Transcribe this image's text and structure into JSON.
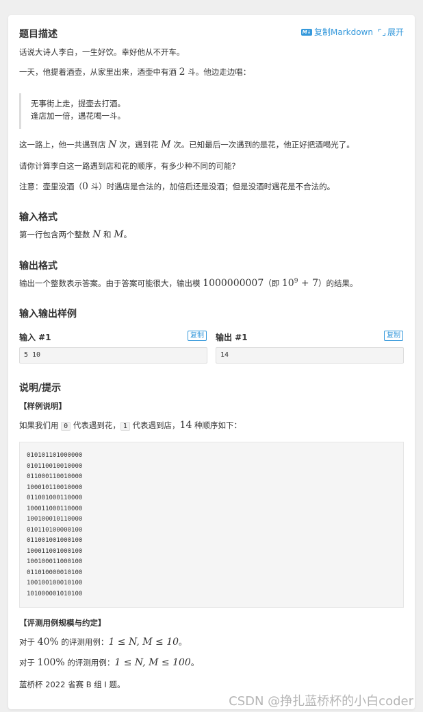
{
  "header": {
    "title": "题目描述",
    "copy_markdown": "复制Markdown",
    "expand": "展开"
  },
  "description": {
    "p1": "话说大诗人李白，一生好饮。幸好他从不开车。",
    "p2_a": "一天，他提着酒壶，从家里出来，酒壶中有酒 ",
    "p2_num": "2",
    "p2_b": " 斗。他边走边唱：",
    "quote_line1": "无事街上走，提壶去打酒。",
    "quote_line2": "逢店加一倍，遇花喝一斗。",
    "p3_a": "这一路上，他一共遇到店 ",
    "p3_N": "N",
    "p3_b": " 次，遇到花 ",
    "p3_M": "M",
    "p3_c": " 次。已知最后一次遇到的是花，他正好把酒喝光了。",
    "p4": "请你计算李白这一路遇到店和花的顺序，有多少种不同的可能?",
    "p5_a": "注意：壶里没酒（",
    "p5_num": "0",
    "p5_b": " 斗）时遇店是合法的，加倍后还是没酒；但是没酒时遇花是不合法的。"
  },
  "input_format": {
    "title": "输入格式",
    "text_a": "第一行包含两个整数 ",
    "N": "N",
    "text_b": " 和 ",
    "M": "M",
    "text_c": "。"
  },
  "output_format": {
    "title": "输出格式",
    "text_a": "输出一个整数表示答案。由于答案可能很大，输出模 ",
    "mod": "1000000007",
    "text_b": "（即 ",
    "pow_base": "10",
    "pow_exp": "9",
    "pow_rest": " + 7",
    "text_c": "）的结果。"
  },
  "samples": {
    "title": "输入输出样例",
    "input_label": "输入 #1",
    "output_label": "输出 #1",
    "copy": "复制",
    "input_value": "5 10",
    "output_value": "14"
  },
  "hint": {
    "title": "说明/提示",
    "sample_explain_title": "【样例说明】",
    "explain_a": "如果我们用 ",
    "code0": "0",
    "explain_b": " 代表遇到花，",
    "code1": "1",
    "explain_c": " 代表遇到店，",
    "explain_num": "14",
    "explain_d": " 种顺序如下：",
    "sequences": [
      "010101101000000",
      "010110010010000",
      "011000110010000",
      "100010110010000",
      "011001000110000",
      "100011000110000",
      "100100010110000",
      "010110100000100",
      "011001001000100",
      "100011001000100",
      "100100011000100",
      "011010000010100",
      "100100100010100",
      "101000001010100"
    ],
    "scale_title": "【评测用例规模与约定】",
    "scale1_a": "对于 ",
    "scale1_pct": "40%",
    "scale1_b": " 的评测用例：",
    "scale1_math": "1 ≤ N, M ≤ 10",
    "scale2_a": "对于 ",
    "scale2_pct": "100%",
    "scale2_b": " 的评测用例：",
    "scale2_math": "1 ≤ N, M ≤ 100",
    "period": "。",
    "source": "蓝桥杯 2022 省赛 B 组 I 题。"
  },
  "watermark": "CSDN @挣扎蓝桥杯的小白coder"
}
